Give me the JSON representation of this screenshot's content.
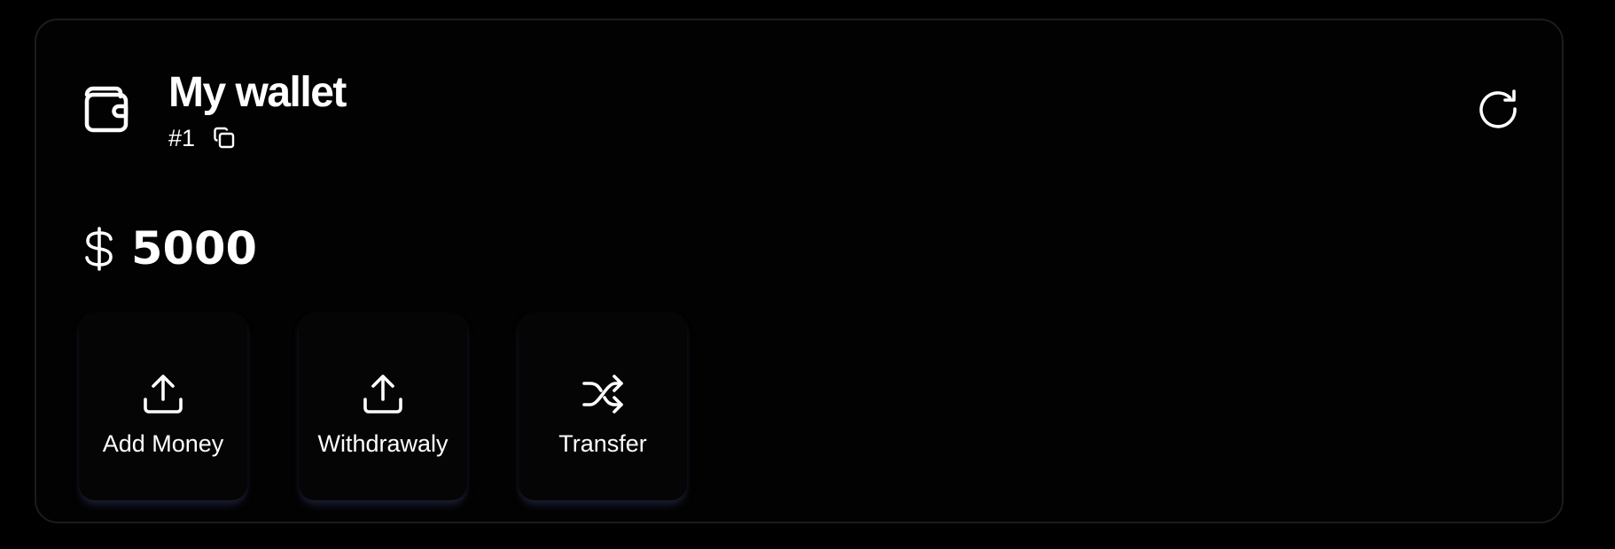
{
  "wallet": {
    "title": "My wallet",
    "id_label": "#1",
    "currency_icon": "dollar-icon",
    "balance": "5000"
  },
  "actions": [
    {
      "label": "Add Money",
      "icon": "upload-icon"
    },
    {
      "label": "Withdrawaly",
      "icon": "upload-icon"
    },
    {
      "label": "Transfer",
      "icon": "shuffle-icon"
    }
  ],
  "colors": {
    "background": "#000000",
    "card": "#020202",
    "border": "#1c1c1c",
    "text": "#ffffff"
  }
}
